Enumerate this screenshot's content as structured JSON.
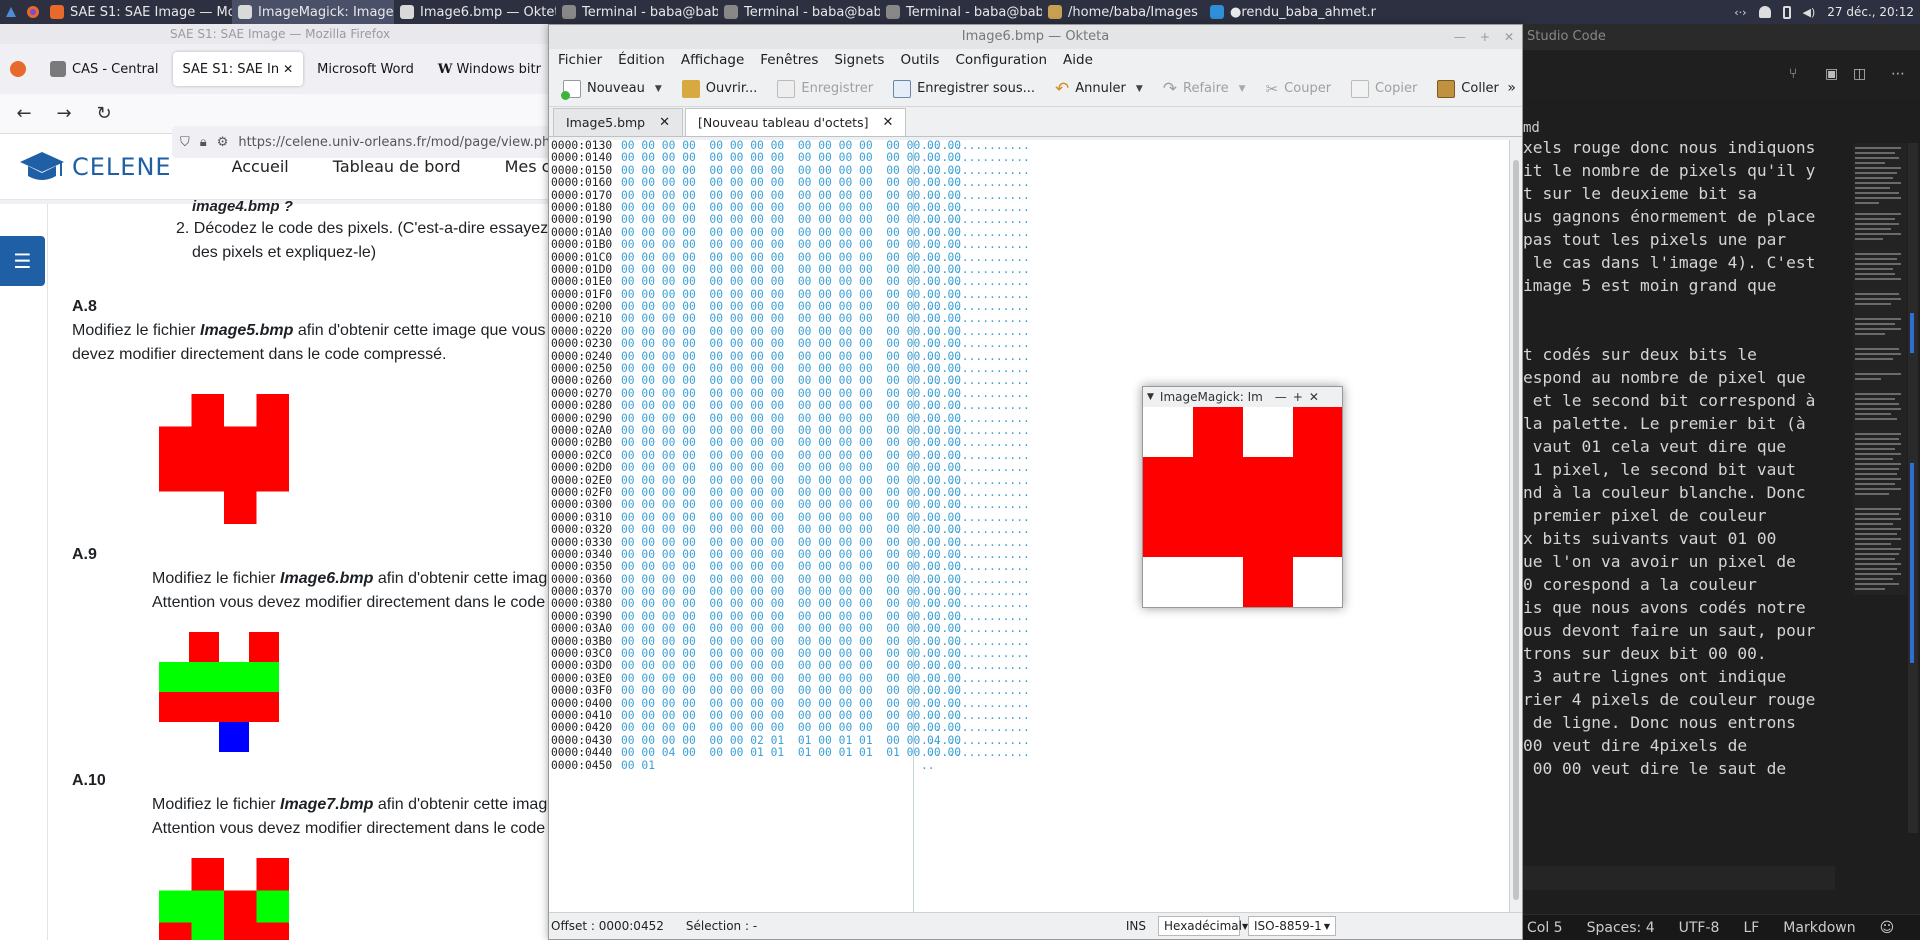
{
  "taskbar": {
    "tasks": [
      {
        "label": "SAE S1: SAE Image — Mozill...",
        "icon_color": "#e8692c"
      },
      {
        "label": "ImageMagick: Image6.bmp",
        "icon_color": "#d9d9d9"
      },
      {
        "label": "Image6.bmp — Okteta",
        "icon_color": "#d9d9d9"
      },
      {
        "label": "Terminal - baba@baba-Virtu...",
        "icon_color": "#888888"
      },
      {
        "label": "Terminal - baba@baba-Virtu...",
        "icon_color": "#888888"
      },
      {
        "label": "Terminal - baba@baba-Virtu...",
        "icon_color": "#888888"
      },
      {
        "label": "/home/baba/Images",
        "icon_color": "#c8a052"
      },
      {
        "label": "●rendu_baba_ahmet.md - s...",
        "icon_color": "#2f8fd8"
      }
    ],
    "clock": "27 déc., 20:12"
  },
  "firefox": {
    "title": "SAE S1: SAE Image — Mozilla Firefox",
    "tabs": [
      "CAS - Central",
      "SAE S1: SAE In",
      "Microsoft Word",
      "Windows bitr"
    ],
    "url": "https://celene.univ-orleans.fr/mod/page/view.ph",
    "celene": {
      "logo": "CELENE",
      "nav": [
        "Accueil",
        "Tableau de bord",
        "Mes cours"
      ]
    },
    "content": {
      "top_bold": "image4.bmp ?",
      "list_item_2_line1": "2.  Décodez le code des pixels. (C'est-a-dire essayez",
      "list_item_2_line2": "des pixels et expliquez-le)",
      "a8_heading": "A.8",
      "a8_line1_pre": "Modifiez le fichier ",
      "a8_file": "Image5.bmp",
      "a8_line1_post": " afin d'obtenir cette image que vous",
      "a8_line2": "devez modifier directement dans le code compressé.",
      "a9_heading": "A.9",
      "a9_line1_pre": "Modifiez le fichier ",
      "a9_file": "Image6.bmp",
      "a9_line1_post": " afin d'obtenir cette imag",
      "a9_line2": "Attention vous devez modifier directement dans le code",
      "a10_heading": "A.10",
      "a10_line1_pre": "Modifiez le fichier ",
      "a10_file": "Image7.bmp",
      "a10_line1_post": " afin d'obtenir cette imag",
      "a10_line2": "Attention vous devez modifier directement dans le code"
    }
  },
  "okteta": {
    "title": "Image6.bmp — Okteta",
    "menu": [
      "Fichier",
      "Édition",
      "Affichage",
      "Fenêtres",
      "Signets",
      "Outils",
      "Configuration",
      "Aide"
    ],
    "toolbar": {
      "new": "Nouveau",
      "open": "Ouvrir...",
      "save": "Enregistrer",
      "save_as": "Enregistrer sous...",
      "undo": "Annuler",
      "redo": "Refaire",
      "cut": "Couper",
      "copy": "Copier",
      "paste": "Coller",
      "overflow": "»"
    },
    "tabs": [
      "Image5.bmp",
      "[Nouveau tableau d'octets]"
    ],
    "hex_rows": [
      {
        "offset": "0000:0130",
        "bytes": "00 00 00 00  00 00 00 00  00 00 00 00  00 00 00 00",
        "chars": "................"
      },
      {
        "offset": "0000:0140",
        "bytes": "00 00 00 00  00 00 00 00  00 00 00 00  00 00 00 00",
        "chars": "................"
      },
      {
        "offset": "0000:0150",
        "bytes": "00 00 00 00  00 00 00 00  00 00 00 00  00 00 00 00",
        "chars": "................"
      },
      {
        "offset": "0000:0160",
        "bytes": "00 00 00 00  00 00 00 00  00 00 00 00  00 00 00 00",
        "chars": "................"
      },
      {
        "offset": "0000:0170",
        "bytes": "00 00 00 00  00 00 00 00  00 00 00 00  00 00 00 00",
        "chars": "................"
      },
      {
        "offset": "0000:0180",
        "bytes": "00 00 00 00  00 00 00 00  00 00 00 00  00 00 00 00",
        "chars": "................"
      },
      {
        "offset": "0000:0190",
        "bytes": "00 00 00 00  00 00 00 00  00 00 00 00  00 00 00 00",
        "chars": "................"
      },
      {
        "offset": "0000:01A0",
        "bytes": "00 00 00 00  00 00 00 00  00 00 00 00  00 00 00 00",
        "chars": "................"
      },
      {
        "offset": "0000:01B0",
        "bytes": "00 00 00 00  00 00 00 00  00 00 00 00  00 00 00 00",
        "chars": "................"
      },
      {
        "offset": "0000:01C0",
        "bytes": "00 00 00 00  00 00 00 00  00 00 00 00  00 00 00 00",
        "chars": "................"
      },
      {
        "offset": "0000:01D0",
        "bytes": "00 00 00 00  00 00 00 00  00 00 00 00  00 00 00 00",
        "chars": "................"
      },
      {
        "offset": "0000:01E0",
        "bytes": "00 00 00 00  00 00 00 00  00 00 00 00  00 00 00 00",
        "chars": "................"
      },
      {
        "offset": "0000:01F0",
        "bytes": "00 00 00 00  00 00 00 00  00 00 00 00  00 00 00 00",
        "chars": "................"
      },
      {
        "offset": "0000:0200",
        "bytes": "00 00 00 00  00 00 00 00  00 00 00 00  00 00 00 00",
        "chars": "................"
      },
      {
        "offset": "0000:0210",
        "bytes": "00 00 00 00  00 00 00 00  00 00 00 00  00 00 00 00",
        "chars": "................"
      },
      {
        "offset": "0000:0220",
        "bytes": "00 00 00 00  00 00 00 00  00 00 00 00  00 00 00 00",
        "chars": "................"
      },
      {
        "offset": "0000:0230",
        "bytes": "00 00 00 00  00 00 00 00  00 00 00 00  00 00 00 00",
        "chars": "................"
      },
      {
        "offset": "0000:0240",
        "bytes": "00 00 00 00  00 00 00 00  00 00 00 00  00 00 00 00",
        "chars": "................"
      },
      {
        "offset": "0000:0250",
        "bytes": "00 00 00 00  00 00 00 00  00 00 00 00  00 00 00 00",
        "chars": "................"
      },
      {
        "offset": "0000:0260",
        "bytes": "00 00 00 00  00 00 00 00  00 00 00 00  00 00 00 00",
        "chars": "................"
      },
      {
        "offset": "0000:0270",
        "bytes": "00 00 00 00  00 00 00 00  00 00 00 00  00 00 00 00",
        "chars": "................"
      },
      {
        "offset": "0000:0280",
        "bytes": "00 00 00 00  00 00 00 00  00 00 00 00  00 00 00 00",
        "chars": "................"
      },
      {
        "offset": "0000:0290",
        "bytes": "00 00 00 00  00 00 00 00  00 00 00 00  00 00 00 00",
        "chars": "................"
      },
      {
        "offset": "0000:02A0",
        "bytes": "00 00 00 00  00 00 00 00  00 00 00 00  00 00 00 00",
        "chars": "................"
      },
      {
        "offset": "0000:02B0",
        "bytes": "00 00 00 00  00 00 00 00  00 00 00 00  00 00 00 00",
        "chars": "................"
      },
      {
        "offset": "0000:02C0",
        "bytes": "00 00 00 00  00 00 00 00  00 00 00 00  00 00 00 00",
        "chars": "................"
      },
      {
        "offset": "0000:02D0",
        "bytes": "00 00 00 00  00 00 00 00  00 00 00 00  00 00 00 00",
        "chars": "................"
      },
      {
        "offset": "0000:02E0",
        "bytes": "00 00 00 00  00 00 00 00  00 00 00 00  00 00 00 00",
        "chars": "................"
      },
      {
        "offset": "0000:02F0",
        "bytes": "00 00 00 00  00 00 00 00  00 00 00 00  00 00 00 00",
        "chars": "................"
      },
      {
        "offset": "0000:0300",
        "bytes": "00 00 00 00  00 00 00 00  00 00 00 00  00 00 00 00",
        "chars": "................"
      },
      {
        "offset": "0000:0310",
        "bytes": "00 00 00 00  00 00 00 00  00 00 00 00  00 00 00 00",
        "chars": "................"
      },
      {
        "offset": "0000:0320",
        "bytes": "00 00 00 00  00 00 00 00  00 00 00 00  00 00 00 00",
        "chars": "................"
      },
      {
        "offset": "0000:0330",
        "bytes": "00 00 00 00  00 00 00 00  00 00 00 00  00 00 00 00",
        "chars": "................"
      },
      {
        "offset": "0000:0340",
        "bytes": "00 00 00 00  00 00 00 00  00 00 00 00  00 00 00 00",
        "chars": "................"
      },
      {
        "offset": "0000:0350",
        "bytes": "00 00 00 00  00 00 00 00  00 00 00 00  00 00 00 00",
        "chars": "................"
      },
      {
        "offset": "0000:0360",
        "bytes": "00 00 00 00  00 00 00 00  00 00 00 00  00 00 00 00",
        "chars": "................"
      },
      {
        "offset": "0000:0370",
        "bytes": "00 00 00 00  00 00 00 00  00 00 00 00  00 00 00 00",
        "chars": "................"
      },
      {
        "offset": "0000:0380",
        "bytes": "00 00 00 00  00 00 00 00  00 00 00 00  00 00 00 00",
        "chars": "................"
      },
      {
        "offset": "0000:0390",
        "bytes": "00 00 00 00  00 00 00 00  00 00 00 00  00 00 00 00",
        "chars": "................"
      },
      {
        "offset": "0000:03A0",
        "bytes": "00 00 00 00  00 00 00 00  00 00 00 00  00 00 00 00",
        "chars": "................"
      },
      {
        "offset": "0000:03B0",
        "bytes": "00 00 00 00  00 00 00 00  00 00 00 00  00 00 00 00",
        "chars": "................"
      },
      {
        "offset": "0000:03C0",
        "bytes": "00 00 00 00  00 00 00 00  00 00 00 00  00 00 00 00",
        "chars": "................"
      },
      {
        "offset": "0000:03D0",
        "bytes": "00 00 00 00  00 00 00 00  00 00 00 00  00 00 00 00",
        "chars": "................"
      },
      {
        "offset": "0000:03E0",
        "bytes": "00 00 00 00  00 00 00 00  00 00 00 00  00 00 00 00",
        "chars": "................"
      },
      {
        "offset": "0000:03F0",
        "bytes": "00 00 00 00  00 00 00 00  00 00 00 00  00 00 00 00",
        "chars": "................"
      },
      {
        "offset": "0000:0400",
        "bytes": "00 00 00 00  00 00 00 00  00 00 00 00  00 00 00 00",
        "chars": "................"
      },
      {
        "offset": "0000:0410",
        "bytes": "00 00 00 00  00 00 00 00  00 00 00 00  00 00 00 00",
        "chars": "................"
      },
      {
        "offset": "0000:0420",
        "bytes": "00 00 00 00  00 00 00 00  00 00 00 00  00 00 00 00",
        "chars": "................"
      },
      {
        "offset": "0000:0430",
        "bytes": "00 00 00 00  00 00 02 01  01 00 01 01  00 00 04 00",
        "chars": "................"
      },
      {
        "offset": "0000:0440",
        "bytes": "00 00 04 00  00 00 01 01  01 00 01 01  01 00 00 00",
        "chars": "................"
      },
      {
        "offset": "0000:0450",
        "bytes": "00 01",
        "chars": ".."
      }
    ],
    "status": {
      "offset": "Offset : 0000:0452",
      "selection": "Sélection : -",
      "mode": "INS",
      "encoding_display": "Hexadécimal",
      "charset": "ISO-8859-1"
    }
  },
  "imagemagick": {
    "title": "ImageMagick: Im"
  },
  "vscode": {
    "title": "Studio Code",
    "filename_fragment": "md",
    "lines": [
      "xels rouge donc nous indiquons",
      "it le nombre de pixels qu'il y",
      "t sur le deuxieme bit sa",
      "us gagnons énormement de place",
      "pas tout les pixels une par",
      " le cas dans l'image 4). C'est",
      "image 5 est moin grand que",
      "",
      "",
      "t codés sur deux bits le",
      "espond au nombre de pixel que",
      " et le second bit correspond à",
      "la palette. Le premier bit (à",
      " vaut 01 cela veut dire que",
      " 1 pixel, le second bit vaut",
      "nd à la couleur blanche. Donc",
      " premier pixel de couleur",
      "x bits suivants vaut 01 00",
      "ue l'on va avoir un pixel de",
      "0 corespond a la couleur",
      "is que nous avons codés notre",
      "ous devont faire un saut, pour",
      "trons sur deux bit 00 00.",
      " 3 autre lignes ont indique",
      "rier 4 pixels de couleur rouge",
      " de ligne. Donc nous entrons",
      "00 veut dire 4pixels de",
      " 00 00 veut dire le saut de"
    ],
    "status": {
      "col": "Col 5",
      "spaces": "Spaces: 4",
      "encoding": "UTF-8",
      "eol": "LF",
      "language": "Markdown"
    }
  },
  "colors": {
    "red": "#ff0000",
    "green": "#00ff00",
    "blue": "#0000ff",
    "white": "#ffffff",
    "celene_blue": "#1f5fa6",
    "hex_blue": "#3aa0d8"
  }
}
